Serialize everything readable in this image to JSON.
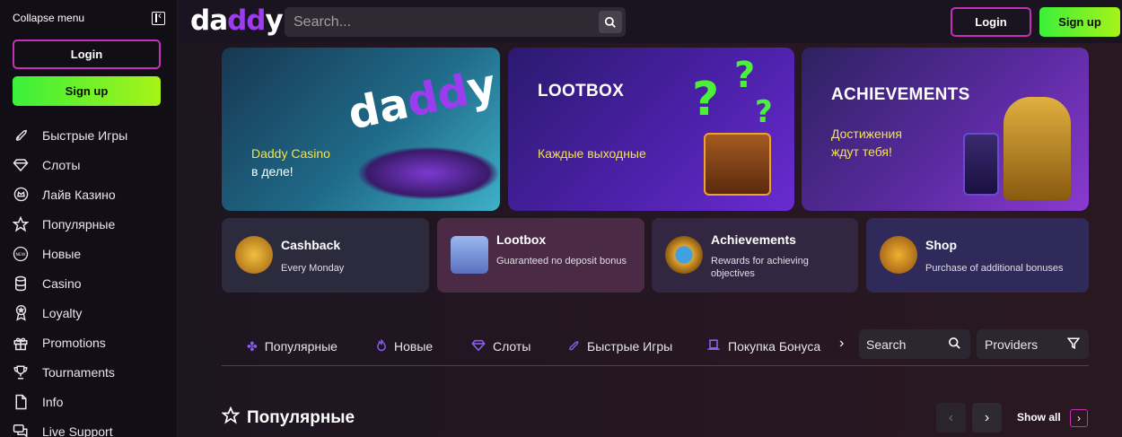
{
  "sidebar": {
    "collapse_label": "Collapse menu",
    "login_label": "Login",
    "signup_label": "Sign up",
    "items": [
      {
        "label": "Быстрые Игры",
        "icon": "rocket-icon"
      },
      {
        "label": "Слоты",
        "icon": "diamond-icon"
      },
      {
        "label": "Лайв Казино",
        "icon": "crown-circle-icon"
      },
      {
        "label": "Популярные",
        "icon": "star-icon"
      },
      {
        "label": "Новые",
        "icon": "new-badge-icon"
      },
      {
        "label": "Casino",
        "icon": "coins-stack-icon"
      },
      {
        "label": "Loyalty",
        "icon": "award-icon"
      },
      {
        "label": "Promotions",
        "icon": "gift-icon"
      },
      {
        "label": "Tournaments",
        "icon": "trophy-icon"
      },
      {
        "label": "Info",
        "icon": "document-icon"
      },
      {
        "label": "Live Support",
        "icon": "chat-icon"
      }
    ]
  },
  "header": {
    "logo_prefix": "da",
    "logo_accent": "dd",
    "logo_suffix": "y",
    "search_placeholder": "Search...",
    "login_label": "Login",
    "signup_label": "Sign up"
  },
  "banners": [
    {
      "logo_prefix": "da",
      "logo_accent": "dd",
      "logo_suffix": "y",
      "line1": "Daddy Casino",
      "line2": "в деле!"
    },
    {
      "title": "LOOTBOX",
      "subtitle": "Каждые выходные"
    },
    {
      "title": "ACHIEVEMENTS",
      "line1": "Достижения",
      "line2": "ждут тебя!"
    }
  ],
  "promo_cards": [
    {
      "title": "Cashback",
      "subtitle": "Every Monday"
    },
    {
      "title": "Lootbox",
      "subtitle": "Guaranteed no deposit bonus"
    },
    {
      "title": "Achievements",
      "subtitle": "Rewards for achieving objectives"
    },
    {
      "title": "Shop",
      "subtitle": "Purchase of additional bonuses"
    }
  ],
  "category_tabs": [
    {
      "label": "Популярные"
    },
    {
      "label": "Новые"
    },
    {
      "label": "Слоты"
    },
    {
      "label": "Быстрые Игры"
    },
    {
      "label": "Покупка Бонуса"
    }
  ],
  "category_search_label": "Search",
  "providers_label": "Providers",
  "section": {
    "title": "Популярные",
    "show_all_label": "Show all"
  },
  "colors": {
    "accent_magenta": "#c530b6",
    "signup_green": "#3bf03b",
    "brand_purple": "#9b3cf0",
    "banner_yellow": "#f4e34a"
  }
}
